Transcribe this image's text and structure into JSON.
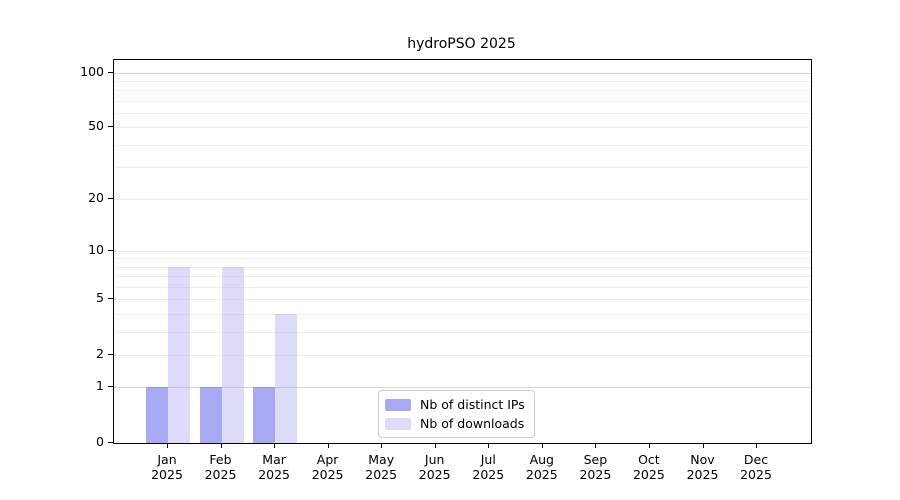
{
  "figure": {
    "background": "#ffffff"
  },
  "chart_data": {
    "type": "bar",
    "title": "hydroPSO 2025",
    "categories": [
      "Jan 2025",
      "Feb 2025",
      "Mar 2025",
      "Apr 2025",
      "May 2025",
      "Jun 2025",
      "Jul 2025",
      "Aug 2025",
      "Sep 2025",
      "Oct 2025",
      "Nov 2025",
      "Dec 2025"
    ],
    "series": [
      {
        "name": "Nb of distinct IPs",
        "color": "rgba(99,99,233,0.55)",
        "color_flat": "#a9a9f3",
        "values": [
          1,
          1,
          1,
          0,
          0,
          0,
          0,
          0,
          0,
          0,
          0,
          0
        ]
      },
      {
        "name": "Nb of downloads",
        "color": "rgba(177,177,239,0.45)",
        "color_flat": "#dcdcf8",
        "values": [
          8,
          8,
          4,
          0,
          0,
          0,
          0,
          0,
          0,
          0,
          0,
          0
        ]
      }
    ],
    "xlabel": "",
    "ylabel": "",
    "yscale": "log1p",
    "ylim": [
      0,
      117
    ],
    "yticks": [
      0,
      1,
      2,
      5,
      10,
      20,
      50,
      100
    ],
    "gridlines": [
      1,
      2,
      3,
      4,
      5,
      6,
      7,
      8,
      9,
      10,
      20,
      30,
      40,
      50,
      60,
      70,
      80,
      90,
      100
    ],
    "emphasized_gridlines": [
      1,
      100
    ],
    "grid": true,
    "legend_position": "inside-bottom-center"
  },
  "colors": {
    "gridline": "#ececec",
    "gridline_emphasized": "#d4d4d4",
    "axis": "#000000",
    "legend_border": "#cccccc"
  }
}
